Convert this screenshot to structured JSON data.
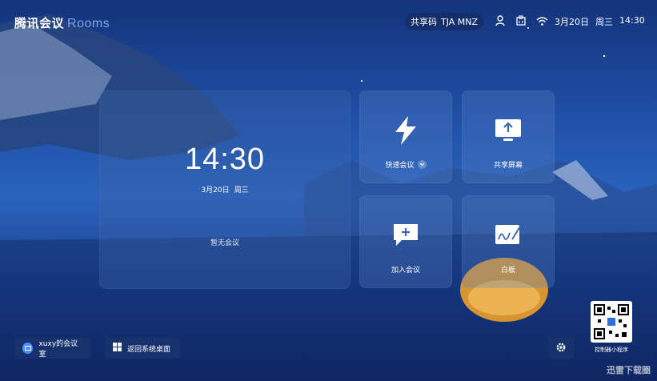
{
  "header": {
    "brand_main": "腾讯会议",
    "brand_sub": "Rooms",
    "share_code_label": "共享码",
    "share_code_value": "TJA MNZ",
    "date": "3月20日",
    "weekday": "周三",
    "time": "14:30",
    "status_icons": [
      "user-icon",
      "network-icon",
      "wifi-icon"
    ]
  },
  "clock": {
    "time": "14:30",
    "date": "3月20日",
    "weekday": "周三",
    "no_meeting": "暂无会议"
  },
  "tiles": {
    "quick": {
      "label": "快速会议",
      "icon": "lightning-icon"
    },
    "share": {
      "label": "共享屏幕",
      "icon": "share-screen-icon"
    },
    "join": {
      "label": "加入会议",
      "icon": "join-meeting-icon"
    },
    "board": {
      "label": "白板",
      "icon": "whiteboard-icon"
    }
  },
  "footer": {
    "room_name": "xuxy的会议室",
    "desktop_label": "返回系统桌面",
    "qr_label": "控制器小程序",
    "watermark": "迅雷下载圈"
  },
  "colors": {
    "accent": "#4a8dff",
    "tile_bg": "rgba(90,130,200,0.30)"
  }
}
